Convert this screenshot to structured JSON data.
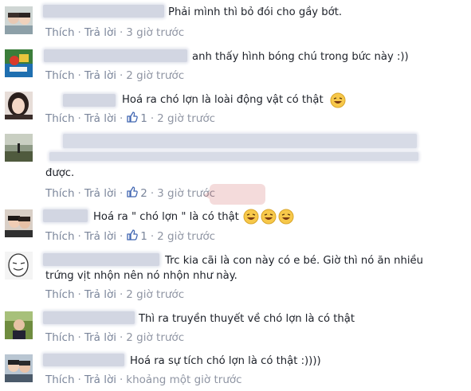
{
  "actions": {
    "like": "Thích",
    "reply": "Trả lời",
    "sep": "·"
  },
  "comments": [
    {
      "text": "Phải mình thì bỏ đói cho gầy bớt.",
      "likes": "",
      "time": "3 giờ trước"
    },
    {
      "text": "anh thấy hình bóng chú trong bức này :))",
      "likes": "",
      "time": "2 giờ trước"
    },
    {
      "text": "Hoá ra chó lợn là loài động vật có thật",
      "likes": "1",
      "time": "2 giờ trước"
    },
    {
      "text": "được.",
      "likes": "2",
      "time": "3 giờ trước"
    },
    {
      "text": "Hoá ra \" chó lợn \" là có thật",
      "likes": "1",
      "time": "2 giờ trước"
    },
    {
      "text_line1": "Trc kia cãi là con này có e bé. Giờ thì nó ăn nhiều",
      "text_line2": "trứng vịt nhộn nên nó nhộn như này.",
      "likes": "",
      "time": "2 giờ trước"
    },
    {
      "text": "Thì ra truyền thuyết về chó lợn là có thật",
      "likes": "",
      "time": "2 giờ trước"
    },
    {
      "text": "Hoá ra sự tích chó lợn là có thật :))))",
      "likes": "",
      "time": "khoảng một giờ trước"
    }
  ],
  "icons": [
    "thumbs-up-icon",
    "laughing-emoji-icon"
  ],
  "colors": {
    "link": "#7b869b",
    "meta": "#8f95a3",
    "like_blue": "#4267b2",
    "emoji_yellow": "#f7c84a"
  }
}
